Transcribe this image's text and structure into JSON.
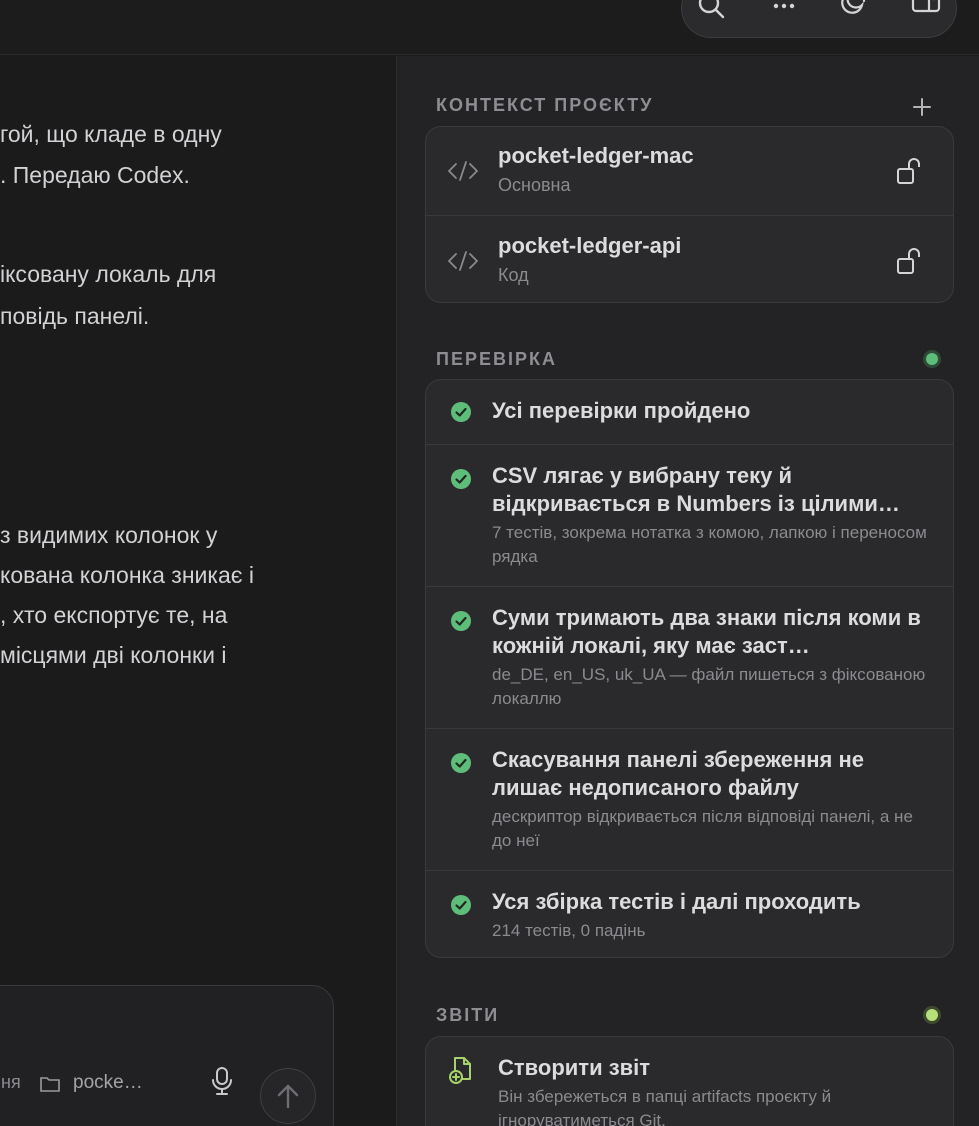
{
  "toolbar": {
    "icons": [
      "search-icon",
      "more-icon",
      "theme-icon",
      "sidebar-toggle-icon"
    ]
  },
  "chat": {
    "lines": [
      "гой, що кладе в одну",
      ". Передаю Codex.",
      "іксовану локаль для",
      "повідь панелі.",
      "з видимих колонок у",
      "кована колонка зникає і",
      ", хто експортує те, на",
      "місцями дві колонки і"
    ]
  },
  "composer": {
    "mode_label": "ня",
    "folder_label": "pocke…",
    "icons": [
      "folder-icon",
      "microphone-icon",
      "send-arrow-icon"
    ]
  },
  "project_context": {
    "title": "КОНТЕКСТ ПРОЄКТУ",
    "items": [
      {
        "name": "pocket-ledger-mac",
        "sub": "Основна"
      },
      {
        "name": "pocket-ledger-api",
        "sub": "Код"
      }
    ]
  },
  "verification": {
    "title": "ПЕРЕВІРКА",
    "status_color": "#5fbd7a",
    "items": [
      {
        "title": "Усі перевірки пройдено",
        "sub": ""
      },
      {
        "title": "CSV лягає у вибрану теку й відкривається в Numbers із цілими…",
        "sub": "7 тестів, зокрема нотатка з комою, лапкою і переносом рядка"
      },
      {
        "title": "Суми тримають два знаки після коми в кожній локалі, яку має заст…",
        "sub": "de_DE, en_US, uk_UA — файл пишеться з фіксованою локаллю"
      },
      {
        "title": "Скасування панелі збереження не лишає недописаного файлу",
        "sub": "дескриптор відкривається після відповіді панелі, а не до неї"
      },
      {
        "title": "Уся збірка тестів і далі проходить",
        "sub": "214 тестів, 0 падінь"
      }
    ]
  },
  "reports": {
    "title": "ЗВІТИ",
    "status_color": "#b7e07a",
    "create_title": "Створити звіт",
    "create_sub": "Він збережеться в папці artifacts проєкту й ігноруватиметься Git."
  },
  "colors": {
    "check_green": "#5fbd7a",
    "report_icon": "#a6d36a"
  }
}
